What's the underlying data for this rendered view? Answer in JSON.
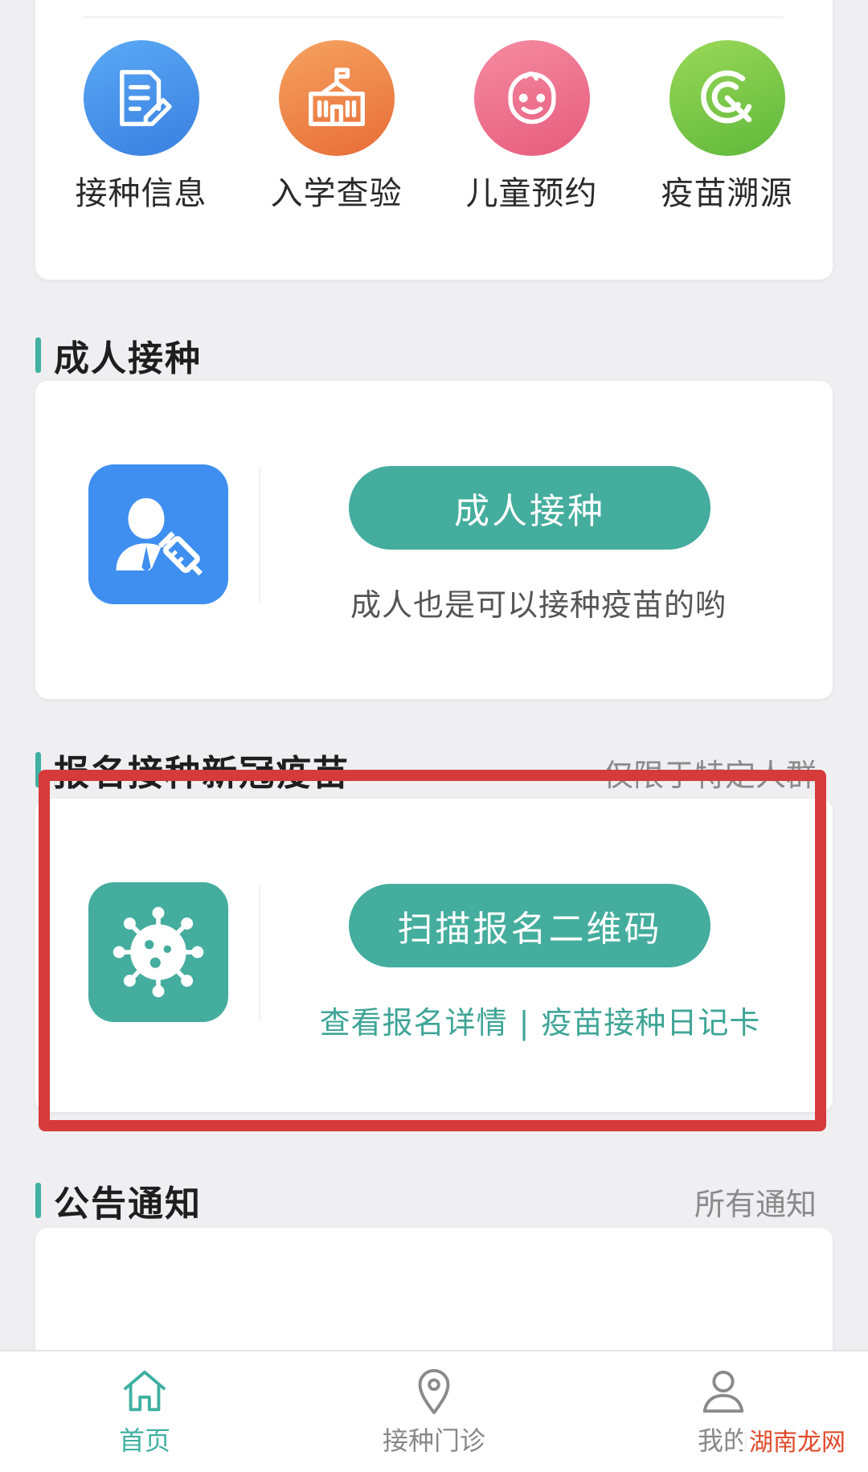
{
  "top_grid": [
    {
      "label": "接种信息",
      "icon": "document-edit-icon",
      "color": "#3a7fe0"
    },
    {
      "label": "入学查验",
      "icon": "school-icon",
      "color": "#e86d38"
    },
    {
      "label": "儿童预约",
      "icon": "baby-face-icon",
      "color": "#e65c7c"
    },
    {
      "label": "疫苗溯源",
      "icon": "trace-icon",
      "color": "#5fb83b"
    }
  ],
  "adult_section": {
    "title": "成人接种",
    "button_label": "成人接种",
    "subtitle": "成人也是可以接种疫苗的哟"
  },
  "covid_section": {
    "title": "报名接种新冠疫苗",
    "right_text": "仅限于特定人群",
    "button_label": "扫描报名二维码",
    "link_details": "查看报名详情",
    "link_separator": "|",
    "link_diary": "疫苗接种日记卡"
  },
  "notice_section": {
    "title": "公告通知",
    "right_link": "所有通知"
  },
  "tabbar": [
    {
      "label": "首页",
      "icon": "home-icon",
      "active": true
    },
    {
      "label": "接种门诊",
      "icon": "location-pin-icon",
      "active": false
    },
    {
      "label": "我的",
      "icon": "user-icon",
      "active": false
    }
  ],
  "watermark": "湖南龙网",
  "colors": {
    "accent": "#44ad9e",
    "highlight": "#d63a3a",
    "adult_icon_bg": "#3f8ff0",
    "covid_icon_bg": "#44ad9e"
  }
}
